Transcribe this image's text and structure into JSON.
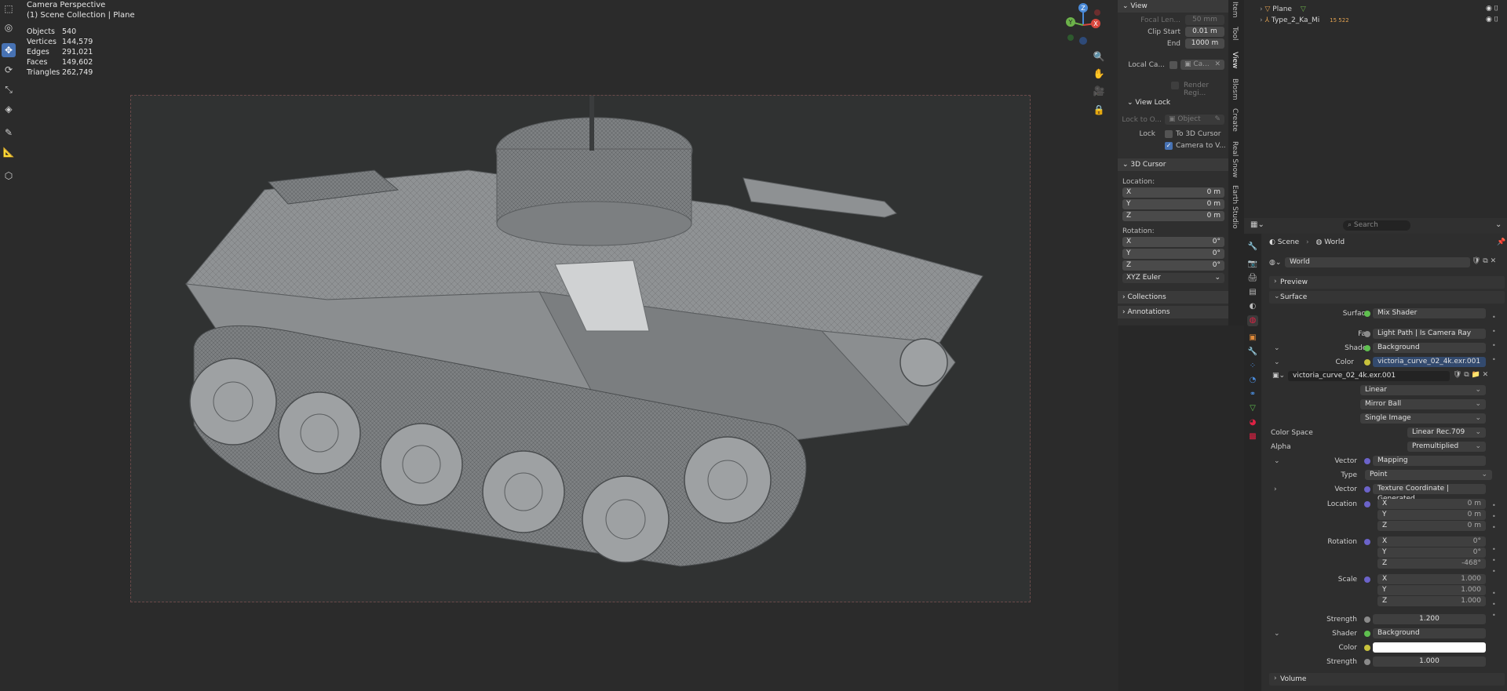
{
  "viewport": {
    "title": "Camera Perspective",
    "collection": "(1) Scene Collection | Plane",
    "stats": [
      {
        "label": "Objects",
        "value": "540"
      },
      {
        "label": "Vertices",
        "value": "144,579"
      },
      {
        "label": "Edges",
        "value": "291,021"
      },
      {
        "label": "Faces",
        "value": "149,602"
      },
      {
        "label": "Triangles",
        "value": "262,749"
      }
    ],
    "gizmo": {
      "x": "X",
      "y": "Y",
      "z": "Z"
    }
  },
  "npanel": {
    "view_header": "View",
    "focal_label": "Focal Len...",
    "focal_value": "50 mm",
    "clip_start_label": "Clip Start",
    "clip_start_value": "0.01 m",
    "end_label": "End",
    "end_value": "1000 m",
    "local_camera_label": "Local Ca...",
    "local_camera_value": "Ca...",
    "render_region_label": "Render Regi...",
    "view_lock_header": "View Lock",
    "lock_to_object_label": "Lock to O...",
    "lock_to_object_value": "Object",
    "lock_label": "Lock",
    "to_cursor_label": "To 3D Cursor",
    "camera_to_view_label": "Camera to V...",
    "cursor_header": "3D Cursor",
    "location_label": "Location:",
    "location": [
      {
        "axis": "X",
        "value": "0 m"
      },
      {
        "axis": "Y",
        "value": "0 m"
      },
      {
        "axis": "Z",
        "value": "0 m"
      }
    ],
    "rotation_label": "Rotation:",
    "rotation": [
      {
        "axis": "X",
        "value": "0°"
      },
      {
        "axis": "Y",
        "value": "0°"
      },
      {
        "axis": "Z",
        "value": "0°"
      }
    ],
    "rotation_mode": "XYZ Euler",
    "collections_header": "Collections",
    "annotations_header": "Annotations"
  },
  "vtabs": [
    "Item",
    "Tool",
    "View",
    "Blosm",
    "Create",
    "Real Snow",
    "Earth Studio"
  ],
  "outliner": {
    "items": [
      {
        "name": "Plane"
      },
      {
        "name": "Type_2_Ka_Mi",
        "badge": "15 522"
      }
    ]
  },
  "properties": {
    "search_placeholder": "Search",
    "breadcrumb_scene": "Scene",
    "breadcrumb_world": "World",
    "world_name": "World",
    "preview_header": "Preview",
    "surface_header": "Surface",
    "surface_label": "Surface",
    "surface_value": "Mix Shader",
    "fac_label": "Fac",
    "fac_value": "Light Path | Is Camera Ray",
    "shader1_label": "Shader",
    "shader1_value": "Background",
    "color1_label": "Color",
    "color1_value": "victoria_curve_02_4k.exr.001",
    "image_name": "victoria_curve_02_4k.exr.001",
    "interpolation": "Linear",
    "projection": "Mirror Ball",
    "source": "Single Image",
    "color_space_label": "Color Space",
    "color_space_value": "Linear Rec.709",
    "alpha_label": "Alpha",
    "alpha_value": "Premultiplied",
    "vector_label": "Vector",
    "vector_value": "Mapping",
    "type_label": "Type",
    "type_value": "Point",
    "vector2_label": "Vector",
    "vector2_value": "Texture Coordinate | Generated",
    "map_location_label": "Location",
    "map_location": [
      {
        "axis": "X",
        "value": "0 m"
      },
      {
        "axis": "Y",
        "value": "0 m"
      },
      {
        "axis": "Z",
        "value": "0 m"
      }
    ],
    "map_rotation_label": "Rotation",
    "map_rotation": [
      {
        "axis": "X",
        "value": "0°"
      },
      {
        "axis": "Y",
        "value": "0°"
      },
      {
        "axis": "Z",
        "value": "-468°"
      }
    ],
    "map_scale_label": "Scale",
    "map_scale": [
      {
        "axis": "X",
        "value": "1.000"
      },
      {
        "axis": "Y",
        "value": "1.000"
      },
      {
        "axis": "Z",
        "value": "1.000"
      }
    ],
    "strength1_label": "Strength",
    "strength1_value": "1.200",
    "shader2_label": "Shader",
    "shader2_value": "Background",
    "color2_label": "Color",
    "strength2_label": "Strength",
    "strength2_value": "1.000",
    "volume_header": "Volume"
  },
  "colors": {
    "accent": "#4772b3",
    "node_green": "#5fbf4f",
    "node_yellow": "#c8c23c",
    "node_purple": "#6b63c9",
    "node_grey": "#8a8a8a"
  }
}
